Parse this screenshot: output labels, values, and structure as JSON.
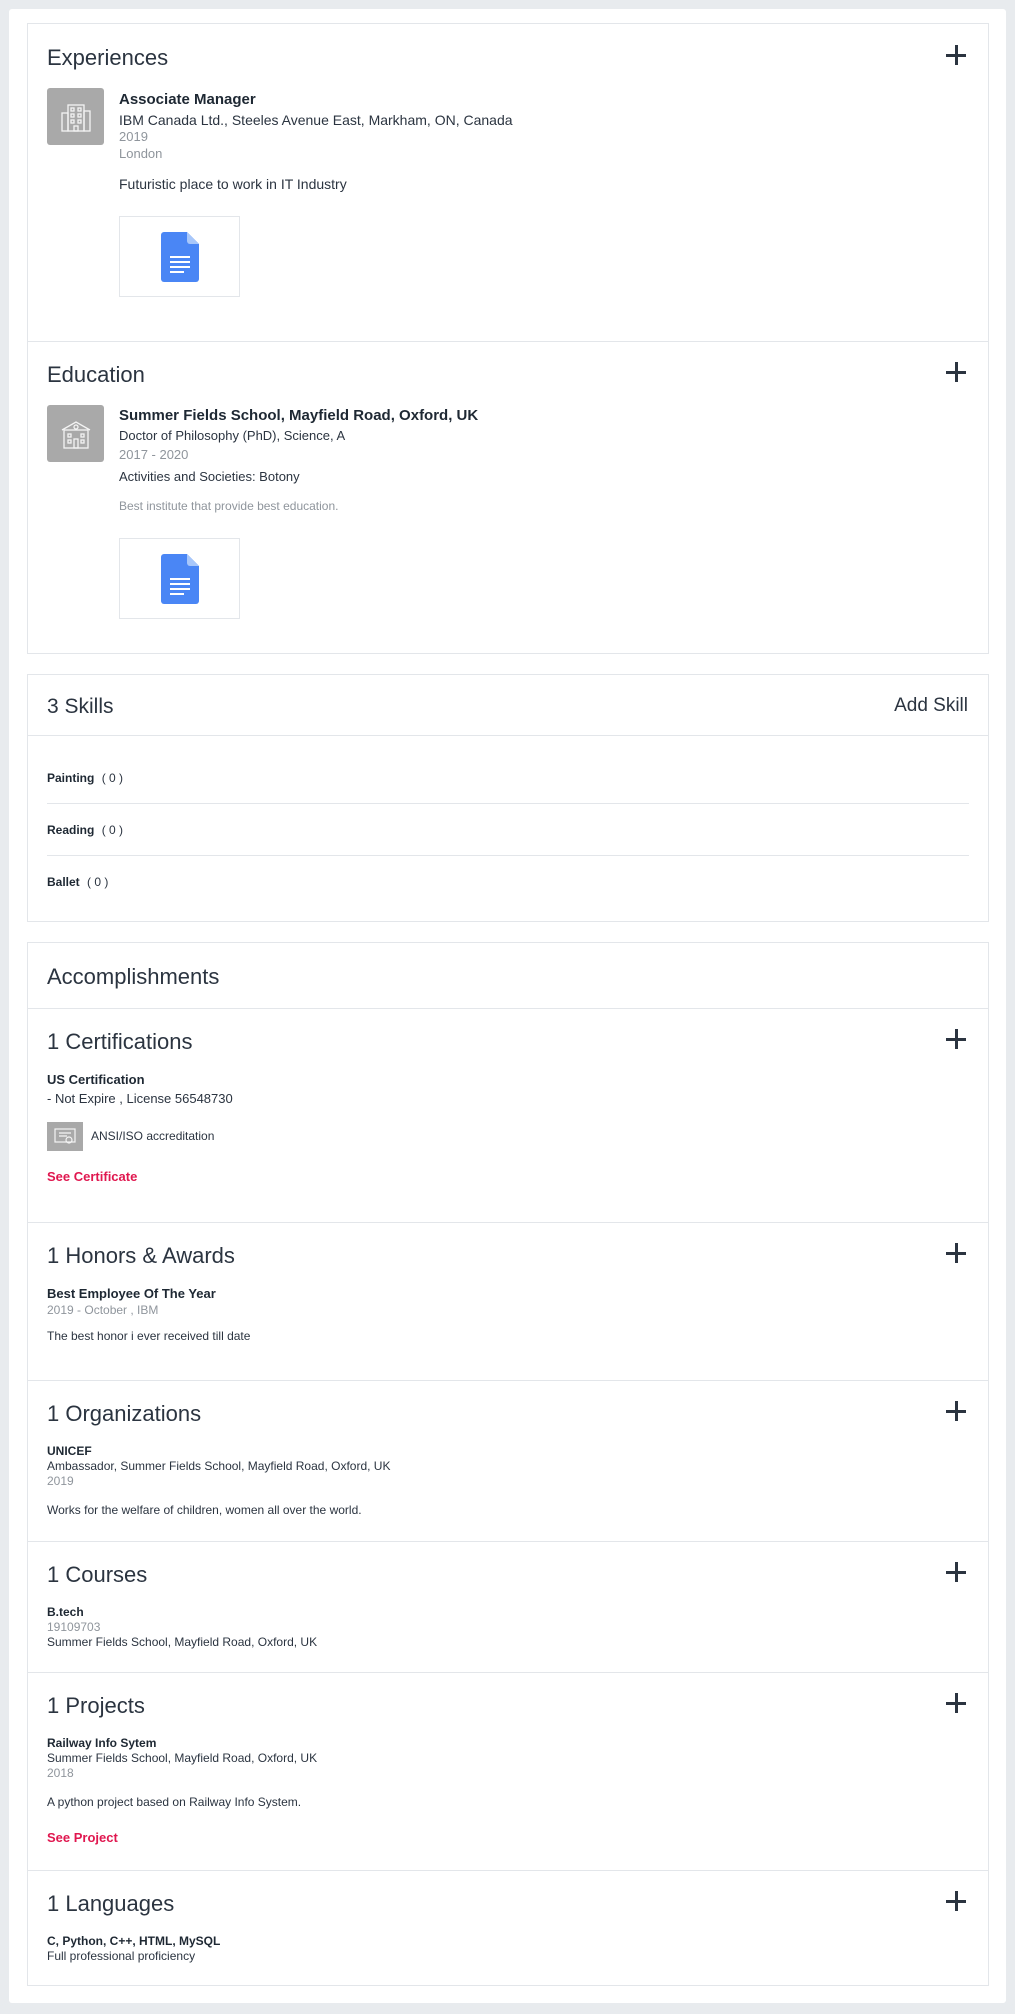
{
  "experiences": {
    "title": "Experiences",
    "item": {
      "role": "Associate Manager",
      "company": "IBM Canada Ltd., Steeles Avenue East, Markham, ON, Canada",
      "year": "2019",
      "location": "London",
      "description": "Futuristic place to work in IT Industry"
    }
  },
  "education": {
    "title": "Education",
    "item": {
      "school": "Summer Fields School, Mayfield Road, Oxford, UK",
      "degree": "Doctor of Philosophy (PhD),  Science,  A",
      "years": "2017 - 2020",
      "activities": "Activities and Societies: Botony",
      "description": "Best institute that provide best education."
    }
  },
  "skills": {
    "title": "3 Skills",
    "add_label": "Add Skill",
    "items": [
      {
        "name": "Painting",
        "count": "( 0 )"
      },
      {
        "name": "Reading",
        "count": "( 0 )"
      },
      {
        "name": "Ballet",
        "count": "( 0 )"
      }
    ]
  },
  "accomplishments": {
    "title": "Accomplishments",
    "certifications": {
      "title": "1 Certifications",
      "name": "US Certification",
      "detail": "- Not Expire , License 56548730",
      "authority": "ANSI/ISO accreditation",
      "link": "See Certificate"
    },
    "honors": {
      "title": "1 Honors & Awards",
      "name": "Best Employee Of The Year",
      "date": "2019 - October , IBM",
      "description": "The best honor i ever received till date"
    },
    "organizations": {
      "title": "1 Organizations",
      "name": "UNICEF",
      "detail": "Ambassador, Summer Fields School, Mayfield Road, Oxford, UK",
      "year": "2019",
      "description": "Works for the welfare of children, women all over the world."
    },
    "courses": {
      "title": "1 Courses",
      "name": "B.tech",
      "number": "19109703",
      "school": "Summer Fields School, Mayfield Road, Oxford, UK"
    },
    "projects": {
      "title": "1 Projects",
      "name": "Railway Info Sytem",
      "school": "Summer Fields School, Mayfield Road, Oxford, UK",
      "year": "2018",
      "description": "A python project based on Railway Info System.",
      "link": "See Project"
    },
    "languages": {
      "title": "1 Languages",
      "name": "C, Python, C++, HTML, MySQL",
      "proficiency": "Full professional proficiency"
    }
  },
  "icons": {
    "add": "plus-icon",
    "company_logo": "building-icon",
    "school_logo": "school-icon",
    "document": "document-icon",
    "cert_logo": "certificate-icon"
  },
  "colors": {
    "accent_link": "#e0174f",
    "doc_blue": "#4a86f5",
    "logo_gray": "#a9a9a9"
  }
}
